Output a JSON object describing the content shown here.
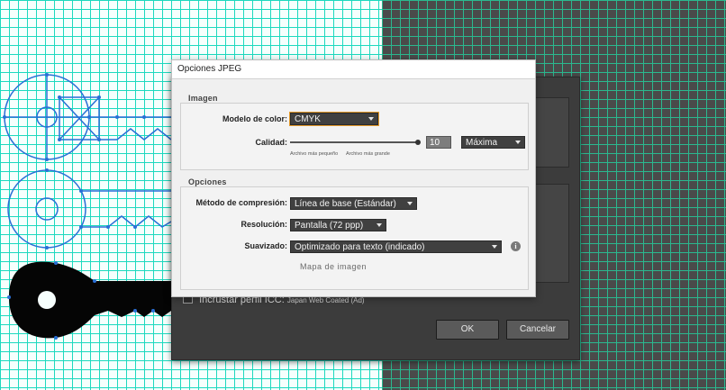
{
  "back_dialog": {
    "icc_label": "Incrustar perfil ICC:",
    "icc_value": "Japan Web Coated (Ad)",
    "ok": "OK",
    "cancel": "Cancelar"
  },
  "dialog": {
    "title": "Opciones JPEG",
    "imagen": {
      "legend": "Imagen",
      "color_model_label": "Modelo de color:",
      "color_model_value": "CMYK",
      "quality_label": "Calidad:",
      "quality_value": "10",
      "quality_level": "Máxima",
      "hint_left": "Archivo más pequeño",
      "hint_right": "Archivo más grande"
    },
    "opciones": {
      "legend": "Opciones",
      "compression_label": "Método de compresión:",
      "compression_value": "Línea de base (Estándar)",
      "resolution_label": "Resolución:",
      "resolution_value": "Pantalla (72 ppp)",
      "antialias_label": "Suavizado:",
      "antialias_value": "Optimizado para texto (indicado)",
      "image_map": "Mapa de imagen"
    }
  },
  "colors": {
    "grid_light": "#1dd9bf",
    "grid_dark": "#2bb88f",
    "accent_focus": "#e49a2a"
  }
}
